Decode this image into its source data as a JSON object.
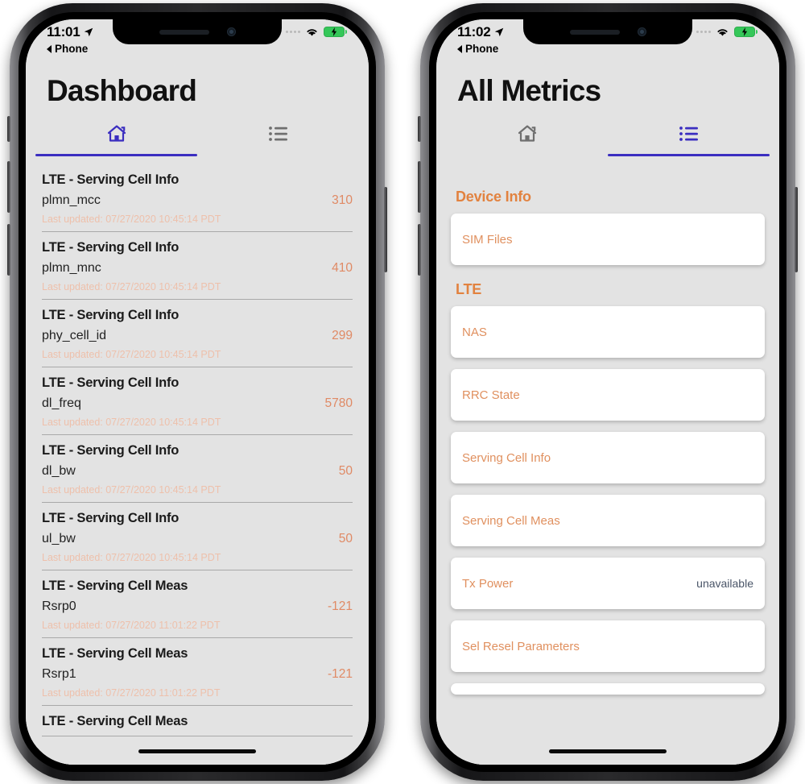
{
  "phones": [
    {
      "id": "left",
      "status_bar": {
        "time": "11:01",
        "location_icon": "location-arrow-icon",
        "wifi_icon": "wifi-icon",
        "battery_icon": "battery-charging-icon",
        "signal_icon": "signal-dots-icon"
      },
      "back_to_app": {
        "label": "Phone",
        "icon": "back-triangle-icon"
      },
      "title": "Dashboard",
      "tabs": [
        {
          "name": "home",
          "icon": "home-icon",
          "active": true
        },
        {
          "name": "list",
          "icon": "list-icon",
          "active": false
        }
      ],
      "list_items": [
        {
          "title": "LTE - Serving Cell Info",
          "key": "plmn_mcc",
          "value": "310",
          "timestamp": "Last updated: 07/27/2020 10:45:14 PDT"
        },
        {
          "title": "LTE - Serving Cell Info",
          "key": "plmn_mnc",
          "value": "410",
          "timestamp": "Last updated: 07/27/2020 10:45:14 PDT"
        },
        {
          "title": "LTE - Serving Cell Info",
          "key": "phy_cell_id",
          "value": "299",
          "timestamp": "Last updated: 07/27/2020 10:45:14 PDT"
        },
        {
          "title": "LTE - Serving Cell Info",
          "key": "dl_freq",
          "value": "5780",
          "timestamp": "Last updated: 07/27/2020 10:45:14 PDT"
        },
        {
          "title": "LTE - Serving Cell Info",
          "key": "dl_bw",
          "value": "50",
          "timestamp": "Last updated: 07/27/2020 10:45:14 PDT"
        },
        {
          "title": "LTE - Serving Cell Info",
          "key": "ul_bw",
          "value": "50",
          "timestamp": "Last updated: 07/27/2020 10:45:14 PDT"
        },
        {
          "title": "LTE - Serving Cell Meas",
          "key": "Rsrp0",
          "value": "-121",
          "timestamp": "Last updated: 07/27/2020 11:01:22 PDT"
        },
        {
          "title": "LTE - Serving Cell Meas",
          "key": "Rsrp1",
          "value": "-121",
          "timestamp": "Last updated: 07/27/2020 11:01:22 PDT"
        },
        {
          "title": "LTE - Serving Cell Meas",
          "key": "",
          "value": "",
          "timestamp": ""
        }
      ]
    },
    {
      "id": "right",
      "status_bar": {
        "time": "11:02",
        "location_icon": "location-arrow-icon",
        "wifi_icon": "wifi-icon",
        "battery_icon": "battery-charging-icon",
        "signal_icon": "signal-dots-icon"
      },
      "back_to_app": {
        "label": "Phone",
        "icon": "back-triangle-icon"
      },
      "title": "All Metrics",
      "tabs": [
        {
          "name": "home",
          "icon": "home-icon",
          "active": false
        },
        {
          "name": "list",
          "icon": "list-icon",
          "active": true
        }
      ],
      "sections": [
        {
          "header": "Device Info",
          "cards": [
            {
              "label": "SIM Files",
              "value": ""
            }
          ]
        },
        {
          "header": "LTE",
          "cards": [
            {
              "label": "NAS",
              "value": ""
            },
            {
              "label": "RRC State",
              "value": ""
            },
            {
              "label": "Serving Cell Info",
              "value": ""
            },
            {
              "label": "Serving Cell Meas",
              "value": ""
            },
            {
              "label": "Tx Power",
              "value": "unavailable"
            },
            {
              "label": "Sel Resel Parameters",
              "value": ""
            }
          ]
        }
      ]
    }
  ],
  "colors": {
    "accent_indigo": "#3b2ec0",
    "accent_orange_header": "#e2823f",
    "accent_orange_label": "#e0905f",
    "value_orange": "#e08a65",
    "timestamp_peach": "#eec0ab",
    "card_value_slate": "#4a5568",
    "screen_bg": "#e3e3e3",
    "battery_green": "#35c759"
  }
}
